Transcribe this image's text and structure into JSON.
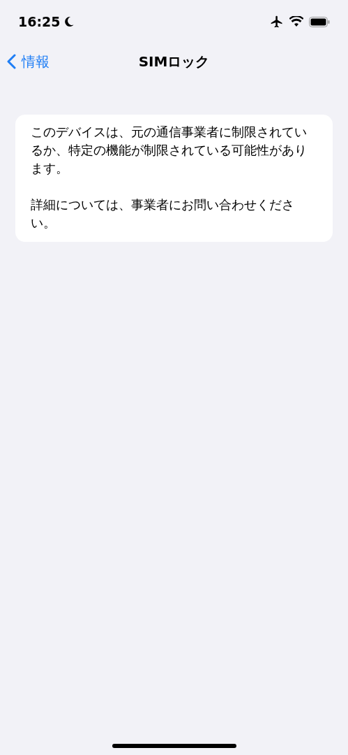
{
  "status_bar": {
    "time": "16:25"
  },
  "nav": {
    "back": "情報",
    "title": "SIMロック"
  },
  "card": {
    "paragraphs": [
      "このデバイスは、元の通信事業者に制限されているか、特定の機能が制限されている可能性があります。",
      "詳細については、事業者にお問い合わせください。"
    ]
  }
}
